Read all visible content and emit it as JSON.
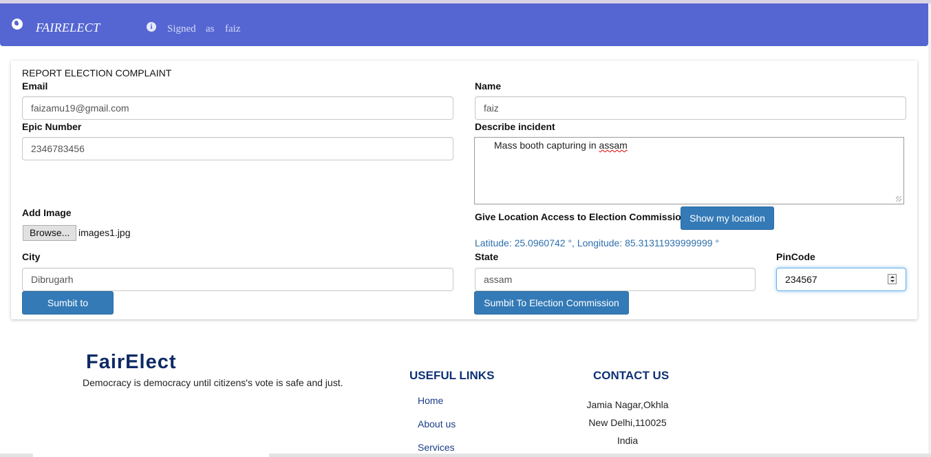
{
  "navbar": {
    "brand": "FAIRELECT",
    "signed_words": [
      "Signed",
      "as",
      "faiz"
    ]
  },
  "form": {
    "title": "REPORT ELECTION COMPLAINT",
    "email": {
      "label": "Email",
      "value": "faizamu19@gmail.com"
    },
    "name": {
      "label": "Name",
      "value": "faiz"
    },
    "epic": {
      "label": "Epic Number",
      "value": "2346783456"
    },
    "incident": {
      "label": "Describe incident",
      "value_prefix": "Mass booth capturing in ",
      "value_flagged": "assam"
    },
    "image": {
      "label": "Add Image",
      "browse_label": "Browse...",
      "filename": "images1.jpg"
    },
    "location": {
      "label": "Give Location Access to Election Commission",
      "button_label": "Show my location",
      "coords": "Latitude: 25.0960742 °, Longitude: 85.31311939999999 °"
    },
    "city": {
      "label": "City",
      "value": "Dibrugarh"
    },
    "state": {
      "label": "State",
      "value": "assam"
    },
    "pincode": {
      "label": "PinCode",
      "value": "234567"
    },
    "submit_record_label": "Sumbit to Record",
    "submit_commission_label": "Sumbit To Election Commission"
  },
  "footer": {
    "brand": "FairElect",
    "tagline": "Democracy is democracy until citizens's vote is safe and just.",
    "links_heading": "USEFUL LINKS",
    "links": [
      "Home",
      "About us",
      "Services"
    ],
    "contact_heading": "CONTACT US",
    "contact_lines": [
      "Jamia Nagar,Okhla",
      "New Delhi,110025",
      "India"
    ]
  },
  "colors": {
    "navbar": "#5566d2",
    "button": "#337ab7",
    "footer_heading": "#0e3175"
  },
  "icons": {
    "globe": "globe-icon",
    "info": "info-icon",
    "spinner": "spinner-icon"
  }
}
